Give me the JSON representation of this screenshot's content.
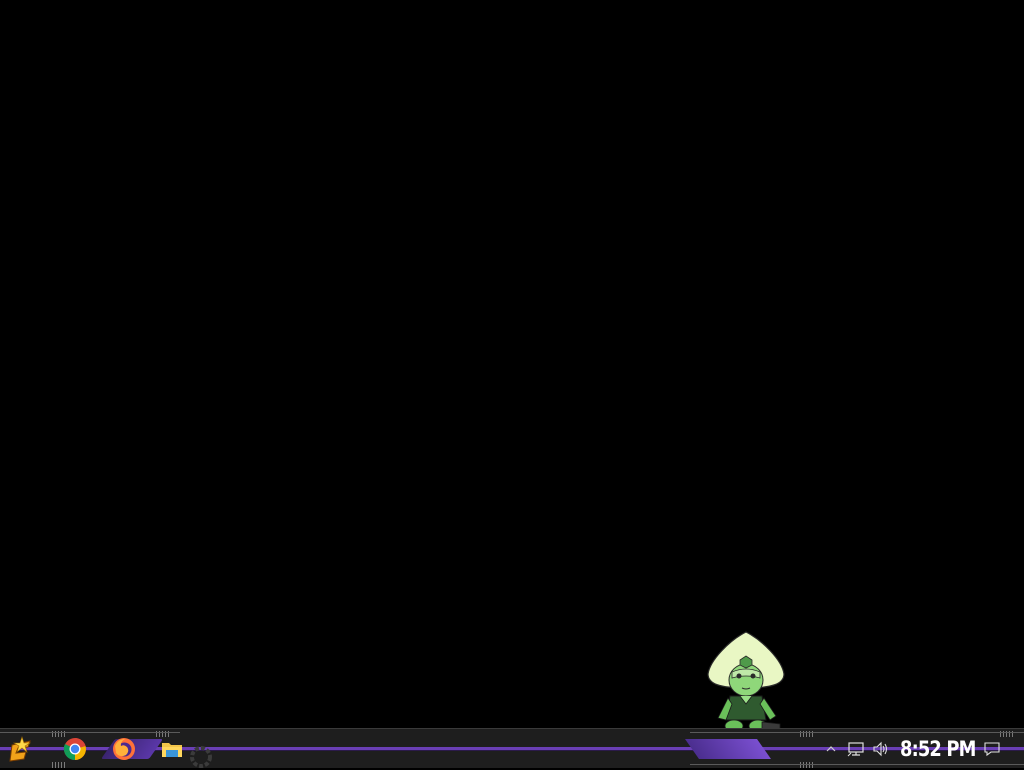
{
  "desktop": {
    "background_color": "#000000",
    "mascot": {
      "icon": "green-gem-character"
    }
  },
  "taskbar": {
    "accent_color": "#6a3fb5",
    "background_color": "#1e1e1e",
    "pinned": [
      {
        "icon": "start-logo-icon"
      },
      {
        "icon": "chrome-icon"
      },
      {
        "icon": "firefox-icon"
      },
      {
        "icon": "file-explorer-icon"
      },
      {
        "icon": "loading-ring-icon"
      }
    ],
    "tray": {
      "overflow_icon": "chevron-up-icon",
      "network_icon": "network-icon",
      "volume_icon": "volume-icon",
      "notification_icon": "action-center-icon"
    },
    "clock": {
      "time": "8:52 PM"
    }
  }
}
